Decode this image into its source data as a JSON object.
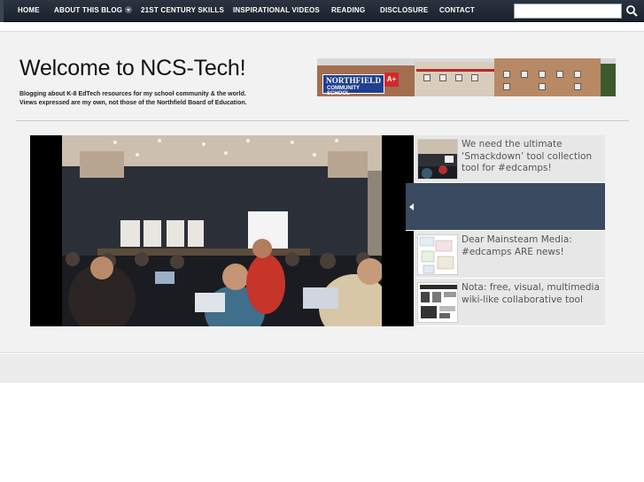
{
  "nav": {
    "items": [
      {
        "label": "HOME"
      },
      {
        "label": "ABOUT THIS BLOG"
      },
      {
        "label": "21ST CENTURY SKILLS"
      },
      {
        "label": "INSPIRATIONAL VIDEOS"
      },
      {
        "label": "READING"
      },
      {
        "label": "DISCLOSURE"
      },
      {
        "label": "CONTACT"
      }
    ],
    "search": {
      "value": "",
      "placeholder": ""
    }
  },
  "header": {
    "title": "Welcome to NCS-Tech!",
    "tagline_1": "Blogging about K-8 EdTech resources for my school community & the world.",
    "tagline_2": "Views expressed are my own, not those of the Northfield Board of Education.",
    "banner_sign_1": "NORTHFIELD",
    "banner_sign_2": "COMMUNITY SCHOOL",
    "banner_logo": "A+"
  },
  "slider": {
    "items": [
      {
        "title": "We need the ultimate ‘Smackdown’ tool collection tool for #edcamps!"
      },
      {
        "title": ""
      },
      {
        "title": "Dear Mainsteam Media: #edcamps ARE news!"
      },
      {
        "title": "Nota: free, visual, multimedia wiki-like collaborative tool"
      }
    ]
  },
  "colors": {
    "nav_bg": "#1f2731",
    "active_slide": "#3a4a60",
    "panel_bg": "#f2f2f2"
  }
}
